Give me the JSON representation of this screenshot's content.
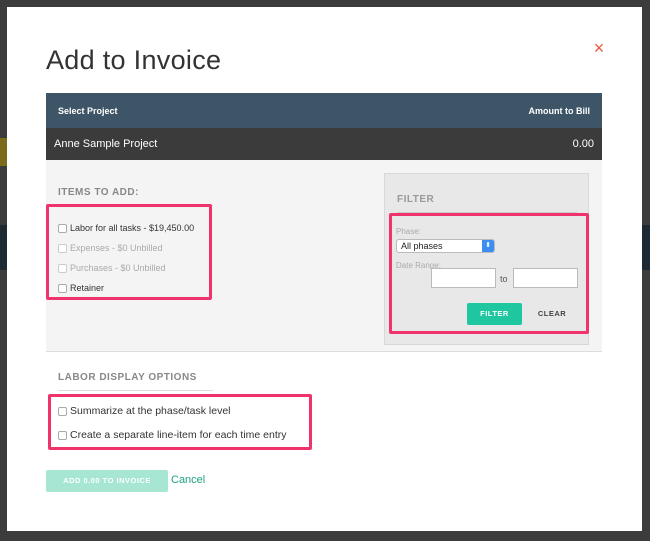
{
  "modal": {
    "title": "Add to Invoice",
    "close_glyph": "×",
    "close_icon": "close-icon"
  },
  "project_table": {
    "col_select_project": "Select Project",
    "col_amount_to_bill": "Amount to Bill",
    "row": {
      "name": "Anne Sample Project",
      "amount": "0.00"
    }
  },
  "items_to_add": {
    "heading": "ITEMS TO ADD:",
    "items": [
      {
        "label": "Labor for all tasks - $19,450.00",
        "checked": false,
        "disabled": false
      },
      {
        "label": "Expenses - $0 Unbilled",
        "checked": false,
        "disabled": true
      },
      {
        "label": "Purchases - $0 Unbilled",
        "checked": false,
        "disabled": true
      },
      {
        "label": "Retainer",
        "checked": false,
        "disabled": false
      }
    ]
  },
  "filter": {
    "heading": "FILTER",
    "phase_label": "Phase:",
    "phase_value": "All phases",
    "phase_arrow": "⬍",
    "date_range_label": "Date Range:",
    "date_from": "",
    "date_to": "",
    "to_label": "to",
    "filter_button": "FILTER",
    "clear_button": "CLEAR"
  },
  "labor_display": {
    "heading": "LABOR DISPLAY OPTIONS",
    "options": [
      {
        "label": "Summarize at the phase/task level",
        "checked": false
      },
      {
        "label": "Create a separate line-item for each time entry",
        "checked": false
      }
    ]
  },
  "footer": {
    "add_button": "ADD 0.00 TO INVOICE",
    "cancel_link": "Cancel"
  },
  "colors": {
    "header_bg": "#3d5566",
    "highlight": "#f0336b",
    "accent": "#1fc7a0",
    "close": "#e8583a"
  }
}
